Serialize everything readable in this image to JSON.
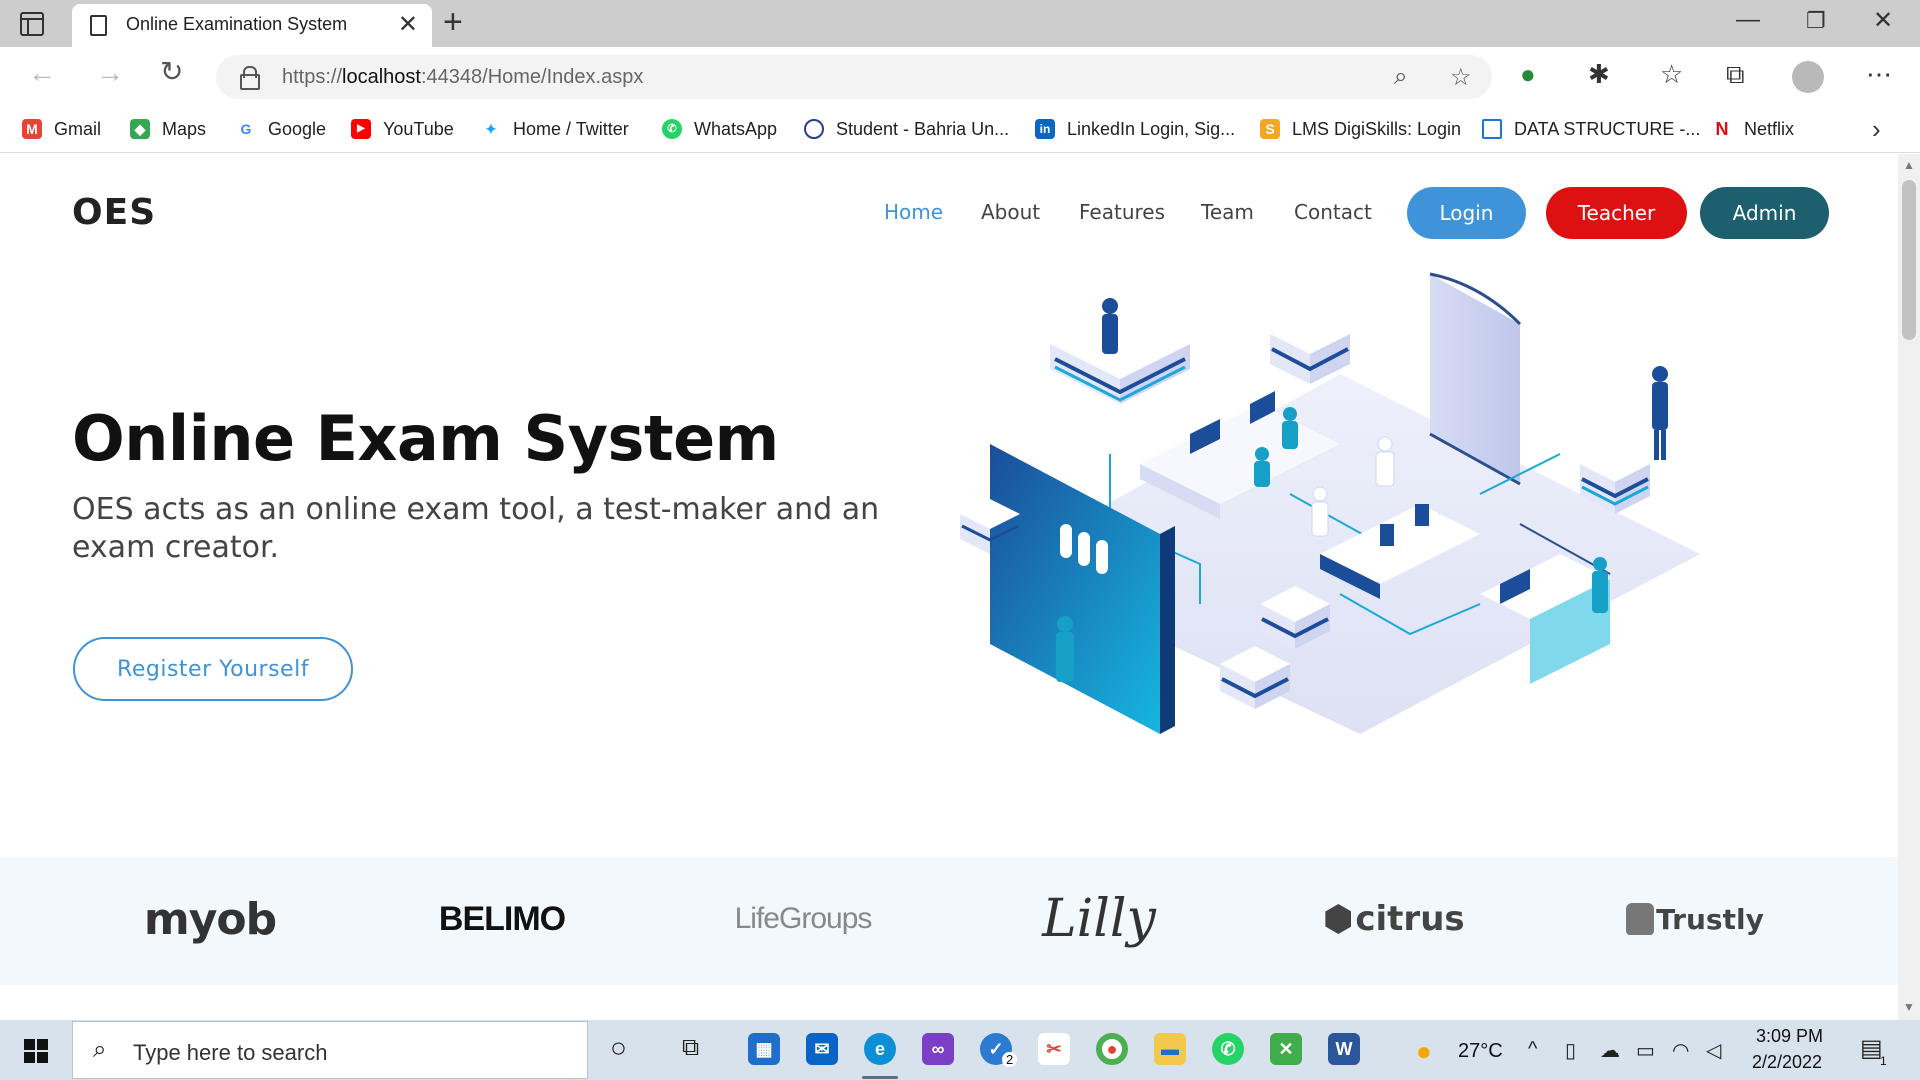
{
  "browser": {
    "tab_title": "Online Examination System",
    "url_scheme": "https://",
    "url_host": "localhost",
    "url_rest": ":44348/Home/Index.aspx"
  },
  "bookmarks": [
    {
      "label": "Gmail",
      "icon": "gmail-icon",
      "color": "#ea4335"
    },
    {
      "label": "Maps",
      "icon": "maps-icon",
      "color": "#34a853"
    },
    {
      "label": "Google",
      "icon": "google-icon",
      "color": "#4285f4"
    },
    {
      "label": "YouTube",
      "icon": "youtube-icon",
      "color": "#ff0000"
    },
    {
      "label": "Home / Twitter",
      "icon": "twitter-icon",
      "color": "#1da1f2"
    },
    {
      "label": "WhatsApp",
      "icon": "whatsapp-icon",
      "color": "#25d366"
    },
    {
      "label": "Student - Bahria Un...",
      "icon": "bahria-icon",
      "color": "#2b3d8f"
    },
    {
      "label": "LinkedIn Login, Sig...",
      "icon": "linkedin-icon",
      "color": "#0a66c2"
    },
    {
      "label": "LMS DigiSkills: Login",
      "icon": "digiskills-icon",
      "color": "#f5a623"
    },
    {
      "label": "DATA STRUCTURE -...",
      "icon": "page-icon",
      "color": "#1a73e8"
    },
    {
      "label": "Netflix",
      "icon": "netflix-icon",
      "color": "#e50914"
    }
  ],
  "site": {
    "logo": "OES",
    "nav": [
      {
        "label": "Home",
        "active": true
      },
      {
        "label": "About",
        "active": false
      },
      {
        "label": "Features",
        "active": false
      },
      {
        "label": "Team",
        "active": false
      },
      {
        "label": "Contact",
        "active": false
      }
    ],
    "buttons": {
      "login": "Login",
      "teacher": "Teacher",
      "admin": "Admin"
    },
    "button_colors": {
      "login": "#3f93d8",
      "teacher": "#dd1111",
      "admin": "#1d5f6e"
    },
    "hero": {
      "title": "Online Exam System",
      "subtitle": "OES acts as an online exam tool, a test-maker and an exam creator.",
      "cta": "Register Yourself"
    },
    "clients": [
      "myob",
      "BELIMO",
      "LifeGroups",
      "Lilly",
      "citrus",
      "Trustly"
    ]
  },
  "taskbar": {
    "search_placeholder": "Type here to search",
    "weather": "27°C",
    "time": "3:09 PM",
    "date": "2/2/2022",
    "notification_count": "1",
    "badge_count": "2"
  }
}
